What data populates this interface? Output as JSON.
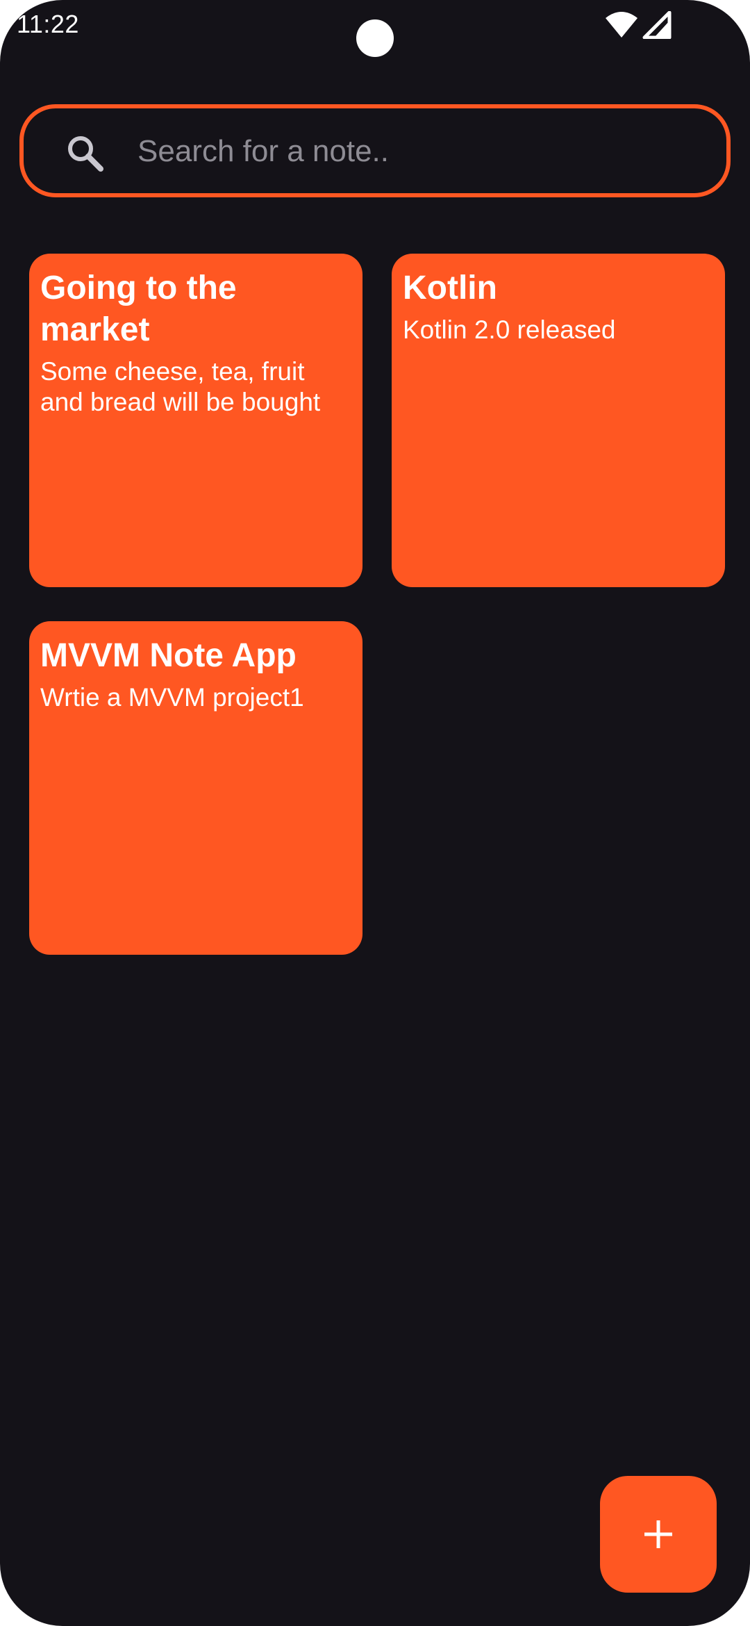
{
  "status_bar": {
    "time": "11:22",
    "icons": [
      "wifi-icon",
      "cellular-signal-icon"
    ]
  },
  "search": {
    "placeholder": "Search for a note..",
    "value": "",
    "icon": "search-icon"
  },
  "notes": [
    {
      "title": "Going to the market",
      "body": "Some cheese, tea, fruit and bread will be bought"
    },
    {
      "title": "Kotlin",
      "body": "Kotlin 2.0 released"
    },
    {
      "title": "MVVM Note App",
      "body": "Wrtie a MVVM project1"
    }
  ],
  "fab": {
    "icon": "add-icon"
  },
  "colors": {
    "background": "#141218",
    "accent": "#FF5722",
    "text": "#FFFFFF",
    "placeholder": "#8E8C94"
  }
}
